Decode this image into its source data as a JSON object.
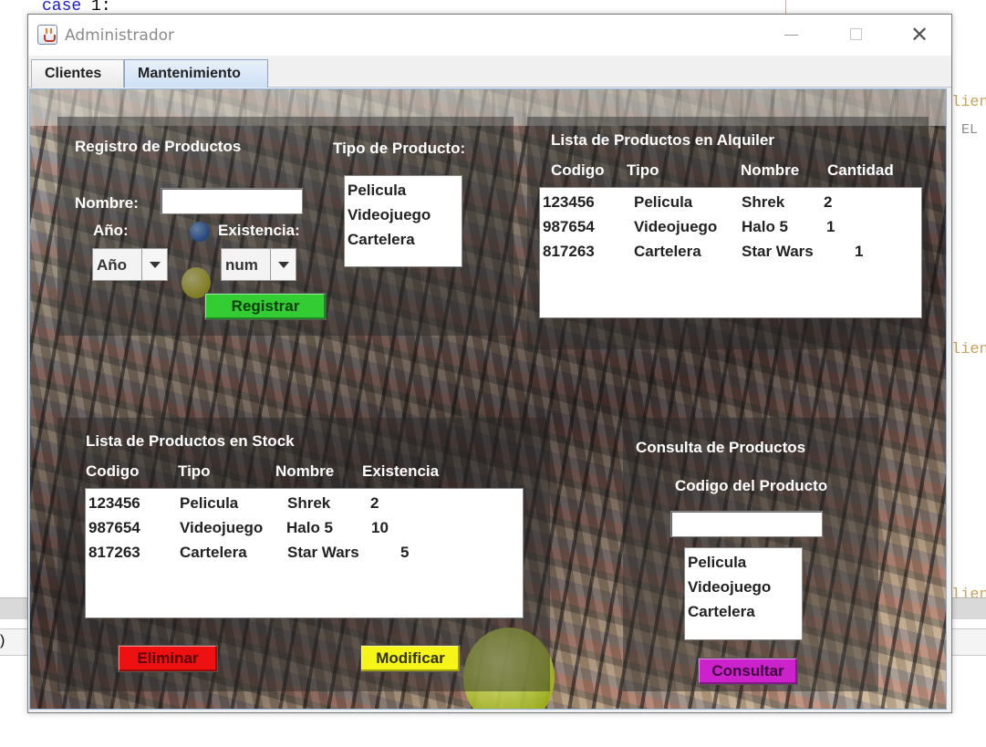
{
  "ide": {
    "code_keyword": "case",
    "code_number": "1:",
    "side_text_1": "lien",
    "side_text_2": "EL",
    "side_text_3": "lien",
    "side_text_4": "lien",
    "paren": ")"
  },
  "window": {
    "title": "Administrador",
    "icon": "java-cup-icon",
    "minimize_icon": "minimize-icon",
    "maximize_icon": "maximize-icon",
    "close_icon": "close-icon",
    "close_glyph": "✕"
  },
  "tabs": [
    {
      "label": "Clientes",
      "selected": false
    },
    {
      "label": "Mantenimiento",
      "selected": true
    }
  ],
  "registro": {
    "title": "Registro de Productos",
    "nombre_label": "Nombre:",
    "nombre_value": "",
    "anio_label": "Año:",
    "anio_value": "Año",
    "existencia_label": "Existencia:",
    "existencia_value": "num",
    "tipo_label": "Tipo de Producto:",
    "tipo_options": [
      "Pelicula",
      "Videojuego",
      "Cartelera"
    ],
    "register_button": "Registrar",
    "register_color": "#33cc33"
  },
  "alquiler": {
    "title": "Lista de Productos en Alquiler",
    "headers": [
      "Codigo",
      "Tipo",
      "Nombre",
      "Cantidad"
    ],
    "rows": [
      [
        "123456",
        "Pelicula",
        "Shrek",
        "2"
      ],
      [
        "987654",
        "Videojuego",
        "Halo 5",
        "1"
      ],
      [
        "817263",
        "Cartelera",
        "Star Wars",
        "1"
      ]
    ]
  },
  "stock": {
    "title": "Lista de Productos en Stock",
    "headers": [
      "Codigo",
      "Tipo",
      "Nombre",
      "Existencia"
    ],
    "rows": [
      [
        "123456",
        "Pelicula",
        "Shrek",
        "2"
      ],
      [
        "987654",
        "Videojuego",
        "Halo 5",
        "10"
      ],
      [
        "817263",
        "Cartelera",
        "Star Wars",
        "5"
      ]
    ],
    "delete_button": "Eliminar",
    "delete_color": "#ee1111",
    "modify_button": "Modificar",
    "modify_color": "#f5f51a"
  },
  "consulta": {
    "title": "Consulta de Productos",
    "codigo_label": "Codigo del Producto",
    "codigo_value": "",
    "tipo_options": [
      "Pelicula",
      "Videojuego",
      "Cartelera"
    ],
    "query_button": "Consultar",
    "query_color": "#cc22cc"
  }
}
